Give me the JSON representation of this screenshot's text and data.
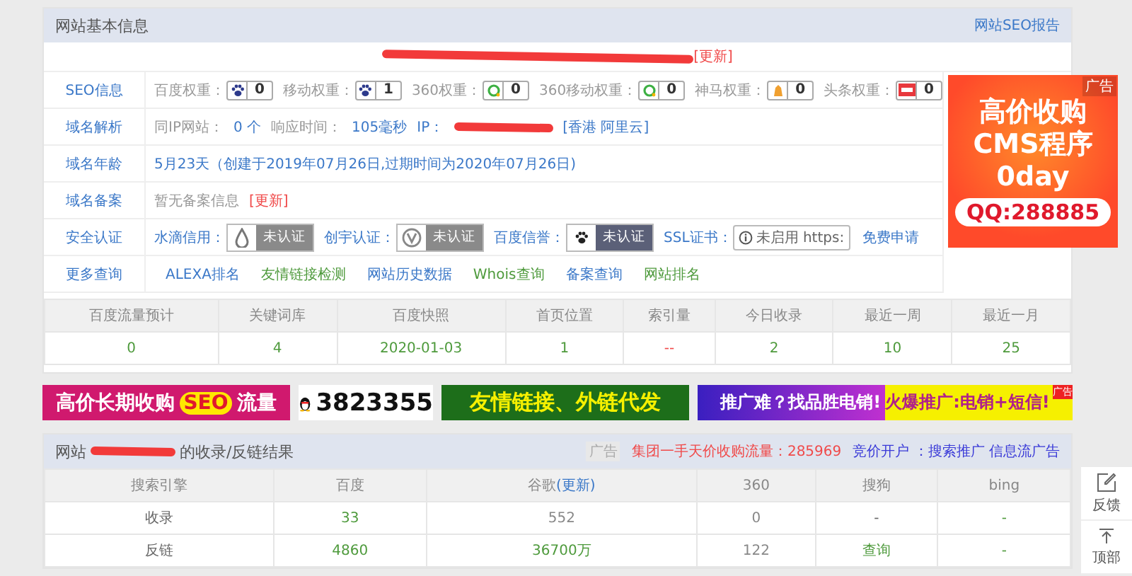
{
  "panel_title": "网站基本信息",
  "report_link": "网站SEO报告",
  "top_line": {
    "update": "[更新]"
  },
  "info_rows": [
    {
      "label": "SEO信息",
      "parts": [
        {
          "kind": "weight",
          "label": "百度权重：",
          "value": "0"
        },
        {
          "kind": "weight",
          "label": "移动权重：",
          "value": "1"
        },
        {
          "kind": "weight",
          "label": "360权重：",
          "value": "0"
        },
        {
          "kind": "weight",
          "label": "360移动权重：",
          "value": "0"
        },
        {
          "kind": "weight",
          "label": "神马权重：",
          "value": "0"
        },
        {
          "kind": "weight",
          "label": "头条权重：",
          "value": "0"
        }
      ]
    },
    {
      "label": "域名解析",
      "parts": [
        {
          "kind": "muted",
          "text": "同IP网站："
        },
        {
          "kind": "link",
          "text": "0 个"
        },
        {
          "kind": "muted",
          "text": "响应时间："
        },
        {
          "kind": "link",
          "text": "105毫秒"
        },
        {
          "kind": "link",
          "text": "IP："
        },
        {
          "kind": "redacted"
        },
        {
          "kind": "link",
          "text": "[香港 阿里云]"
        }
      ]
    },
    {
      "label": "域名年龄",
      "parts": [
        {
          "kind": "link",
          "text": "5月23天（创建于2019年07月26日,过期时间为2020年07月26日)"
        }
      ]
    },
    {
      "label": "域名备案",
      "parts": [
        {
          "kind": "muted",
          "text": "暂无备案信息"
        },
        {
          "kind": "update",
          "text": "[更新]"
        }
      ]
    },
    {
      "label": "安全认证",
      "parts": [
        {
          "kind": "cert",
          "label": "水滴信用：",
          "status": "未认证"
        },
        {
          "kind": "cert",
          "label": "创宇认证：",
          "status": "未认证"
        },
        {
          "kind": "cert",
          "label": "百度信誉：",
          "status": "未认证"
        },
        {
          "kind": "ssl",
          "label": "SSL证书：",
          "status": "未启用 https:",
          "link": "免费申请"
        }
      ]
    },
    {
      "label": "更多查询",
      "parts": [
        {
          "kind": "more",
          "text": "ALEXA排名",
          "color": "#3b78c8"
        },
        {
          "kind": "more",
          "text": "友情链接检测",
          "color": "#4e9a3c"
        },
        {
          "kind": "more",
          "text": "网站历史数据",
          "color": "#3b78c8"
        },
        {
          "kind": "more",
          "text": "Whois查询",
          "color": "#4e9a3c"
        },
        {
          "kind": "more",
          "text": "备案查询",
          "color": "#3b78c8"
        },
        {
          "kind": "more",
          "text": "网站排名",
          "color": "#4e9a3c"
        }
      ]
    }
  ],
  "side_ad": {
    "tag": "广告",
    "lines": [
      "高价收购",
      "CMS程序",
      "0day"
    ],
    "contact": "QQ:288885"
  },
  "stats": {
    "columns": [
      "百度流量预计",
      "关键词库",
      "百度快照",
      "首页位置",
      "索引量",
      "今日收录",
      "最近一周",
      "最近一月"
    ],
    "values": [
      {
        "text": "0",
        "color": "#4e9a3c"
      },
      {
        "text": "4",
        "color": "#4e9a3c"
      },
      {
        "text": "2020-01-03",
        "color": "#4e9a3c"
      },
      {
        "text": "1",
        "color": "#4e9a3c"
      },
      {
        "text": "--",
        "color": "#f04a4a"
      },
      {
        "text": "2",
        "color": "#4e9a3c"
      },
      {
        "text": "10",
        "color": "#4e9a3c"
      },
      {
        "text": "25",
        "color": "#4e9a3c"
      }
    ]
  },
  "banners": [
    {
      "kind": "seo",
      "parts": [
        "高价长期收购",
        "SEO",
        "流量"
      ]
    },
    {
      "kind": "qq",
      "parts": [
        "3823355"
      ]
    },
    {
      "kind": "links",
      "parts": [
        "友情链接、外链代发"
      ]
    },
    {
      "kind": "promo",
      "parts": [
        "推广难？找品胜电销!",
        "火爆推广:电销+短信!"
      ],
      "tag": "广告"
    }
  ],
  "results": {
    "title_start": "网站",
    "title_end": "的收录/反链结果",
    "ad_tag": "广告",
    "ad_text": "集团一手天价收购流量：285969",
    "ad_links": "竞价开户 ：搜索推广 信息流广告",
    "columns": [
      {
        "text": "搜索引擎"
      },
      {
        "text": "百度"
      },
      {
        "text": "谷歌",
        "update": "(更新)"
      },
      {
        "text": "360"
      },
      {
        "text": "搜狗"
      },
      {
        "text": "bing"
      }
    ],
    "rows": [
      [
        {
          "text": "收录",
          "color": "#666666"
        },
        {
          "text": "33",
          "color": "#4e9a3c"
        },
        {
          "text": "552",
          "color": "#888888"
        },
        {
          "text": "0",
          "color": "#888888"
        },
        {
          "text": "-",
          "color": "#666666"
        },
        {
          "text": "-",
          "color": "#4e9a3c"
        }
      ],
      [
        {
          "text": "反链",
          "color": "#666666"
        },
        {
          "text": "4860",
          "color": "#4e9a3c"
        },
        {
          "text": "36700万",
          "color": "#4e9a3c"
        },
        {
          "text": "122",
          "color": "#888888"
        },
        {
          "text": "查询",
          "color": "#4e9a3c"
        },
        {
          "text": "-",
          "color": "#4e9a3c"
        }
      ]
    ]
  },
  "side_tools": [
    {
      "kind": "feedback",
      "label": "反馈"
    },
    {
      "kind": "top",
      "label": "顶部"
    }
  ]
}
